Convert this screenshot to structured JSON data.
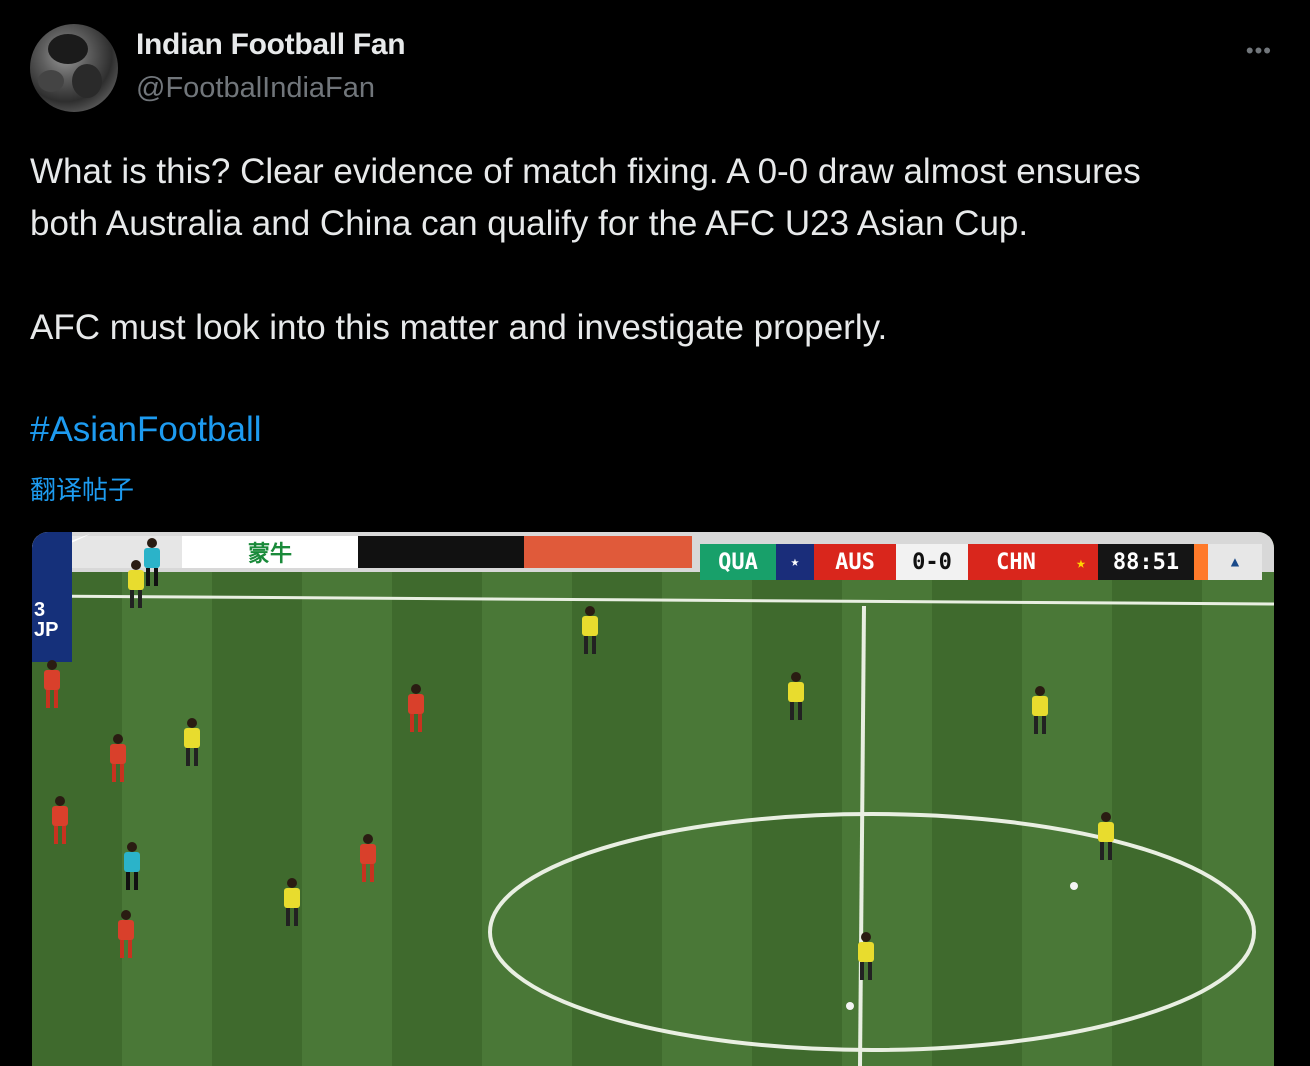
{
  "author": {
    "display_name": "Indian Football Fan",
    "handle": "@FootbalIndiaFan"
  },
  "more_glyph": "•••",
  "tweet": {
    "line1": "What is this? Clear evidence of match fixing. A 0-0 draw almost ensures",
    "line2": "both Australia and China can qualify for the AFC U23 Asian Cup.",
    "line3": "AFC must look into this matter and investigate properly.",
    "hashtag": "#AsianFootball",
    "translate_label": "翻译帖子"
  },
  "media": {
    "side_tag": "3 JP",
    "ad_brand_1": "蒙牛",
    "scoreboard": {
      "qual_label": "QUA",
      "home": "AUS",
      "score": "0-0",
      "away": "CHN",
      "clock": "88:51",
      "home_color": "#d9261c",
      "away_color": "#d9261c"
    }
  },
  "colors": {
    "link": "#1d9bf0",
    "text": "#e7e9ea",
    "muted": "#71767b",
    "pitch_dark": "#3f6a2d",
    "pitch_light": "#4a7837",
    "aus_kit": "#e8dc2e",
    "chn_kit": "#d9402b"
  }
}
